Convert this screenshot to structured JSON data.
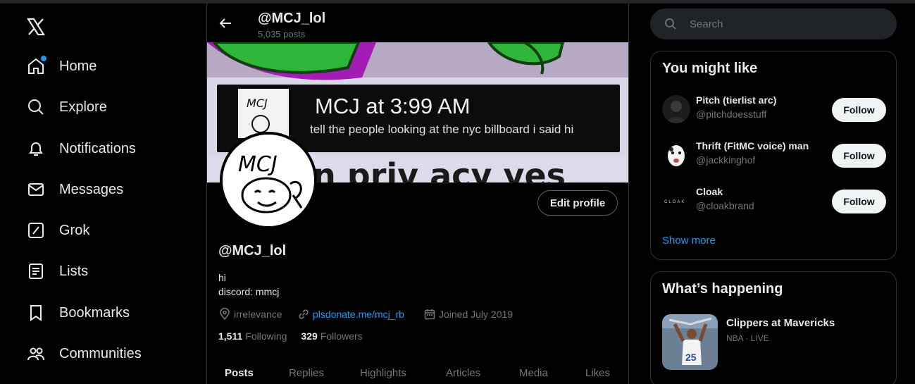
{
  "sidebar": {
    "logo": "x-logo-icon",
    "items": [
      {
        "label": "Home",
        "icon": "home-icon",
        "has_notification_dot": true
      },
      {
        "label": "Explore",
        "icon": "search-icon"
      },
      {
        "label": "Notifications",
        "icon": "bell-icon"
      },
      {
        "label": "Messages",
        "icon": "envelope-icon"
      },
      {
        "label": "Grok",
        "icon": "grok-icon"
      },
      {
        "label": "Lists",
        "icon": "list-icon"
      },
      {
        "label": "Bookmarks",
        "icon": "bookmark-icon"
      },
      {
        "label": "Communities",
        "icon": "communities-icon"
      }
    ]
  },
  "header": {
    "title": "@MCJ_lol",
    "post_count": "5,035 posts"
  },
  "banner": {
    "card_title": "MCJ at 3:99 AM",
    "card_subtitle": "tell the people looking at the nyc billboard i said hi",
    "logo_text": "MCJ",
    "bottom_text": "n priv acy yes"
  },
  "profile": {
    "avatar_text": "MCJ",
    "edit_button": "Edit profile",
    "display_name": "@MCJ_lol",
    "bio_line1": "hi",
    "bio_line2": "discord: mmcj",
    "location": "irrelevance",
    "website": "plsdonate.me/mcj_rb",
    "joined": "Joined July 2019",
    "following_count": "1,511",
    "following_label": "Following",
    "followers_count": "329",
    "followers_label": "Followers"
  },
  "tabs": [
    "Posts",
    "Replies",
    "Highlights",
    "Articles",
    "Media",
    "Likes"
  ],
  "active_tab": "Posts",
  "search": {
    "placeholder": "Search"
  },
  "suggestions": {
    "title": "You might like",
    "users": [
      {
        "name": "Pitch (tierlist arc)",
        "handle": "@pitchdoesstuff",
        "button": "Follow"
      },
      {
        "name": "Thrift (FitMC voice) man",
        "handle": "@jackkinghof",
        "button": "Follow"
      },
      {
        "name": "Cloak",
        "handle": "@cloakbrand",
        "button": "Follow",
        "avatar_text": "CLOAK"
      }
    ],
    "show_more": "Show more"
  },
  "trending": {
    "title": "What’s happening",
    "items": [
      {
        "title": "Clippers at Mavericks",
        "subtitle": "NBA · LIVE",
        "jersey_number": "25"
      }
    ]
  },
  "colors": {
    "accent": "#1d9bf0",
    "background": "#000000",
    "border": "#2f3336",
    "muted_text": "#71767b"
  }
}
